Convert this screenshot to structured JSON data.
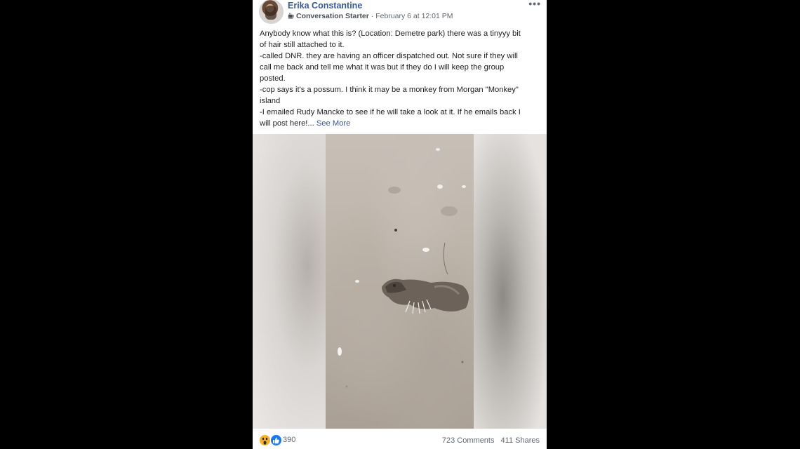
{
  "post": {
    "author": "Erika Constantine",
    "badge": "Conversation Starter",
    "timestamp": "· February 6 at 12:01 PM",
    "more_label": "•••",
    "text_lines": [
      "Anybody know what this is? (Location: Demetre park) there was a tinyyy bit",
      "of hair still attached to it.",
      "-called DNR. they are having an officer dispatched out. Not sure if they will",
      "call me back and tell me what it was but if they do I will keep the group",
      "posted.",
      "-cop says it's a possum. I think it may be a monkey from Morgan \"Monkey\"",
      "island",
      "-I emailed Rudy Mancke to see if he will take a look at it. If he emails back I"
    ],
    "last_line": "will post here!...",
    "see_more": "See More"
  },
  "footer": {
    "reaction_icons": [
      "wow-reaction-icon",
      "like-reaction-icon"
    ],
    "reaction_count": "390",
    "comments": "723 Comments",
    "shares": "411 Shares"
  },
  "colors": {
    "link_blue": "#385898",
    "meta_gray": "#616770",
    "like_blue": "#1877f2",
    "wow_yellow": "#f7b125"
  }
}
